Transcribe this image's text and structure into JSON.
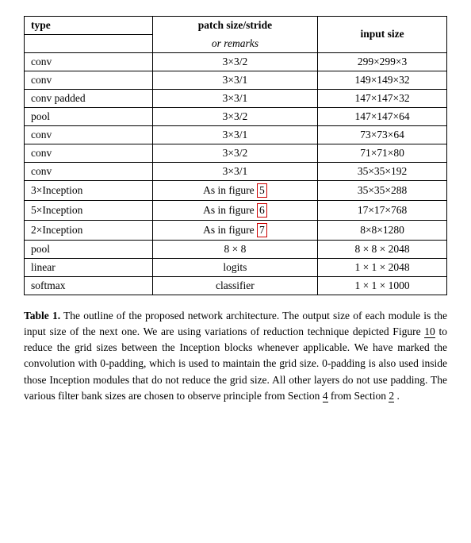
{
  "table": {
    "headers": {
      "type": "type",
      "patch": "patch size/stride",
      "remarks": "or remarks",
      "input": "input size"
    },
    "rows": [
      {
        "type": "conv",
        "patch": "3×3/2",
        "input": "299×299×3"
      },
      {
        "type": "conv",
        "patch": "3×3/1",
        "input": "149×149×32"
      },
      {
        "type": "conv padded",
        "patch": "3×3/1",
        "input": "147×147×32"
      },
      {
        "type": "pool",
        "patch": "3×3/2",
        "input": "147×147×64"
      },
      {
        "type": "conv",
        "patch": "3×3/1",
        "input": "73×73×64"
      },
      {
        "type": "conv",
        "patch": "3×3/2",
        "input": "71×71×80"
      },
      {
        "type": "conv",
        "patch": "3×3/1",
        "input": "35×35×192"
      },
      {
        "type": "3×Inception",
        "patch": "As in figure 5",
        "input": "35×35×288",
        "highlight": "5"
      },
      {
        "type": "5×Inception",
        "patch": "As in figure 6",
        "input": "17×17×768",
        "highlight": "6"
      },
      {
        "type": "2×Inception",
        "patch": "As in figure 7",
        "input": "8×8×1280",
        "highlight": "7"
      },
      {
        "type": "pool",
        "patch": "8 × 8",
        "input": "8 × 8 × 2048"
      },
      {
        "type": "linear",
        "patch": "logits",
        "input": "1 × 1 × 2048"
      },
      {
        "type": "softmax",
        "patch": "classifier",
        "input": "1 × 1 × 1000"
      }
    ]
  },
  "caption": {
    "label": "Table 1.",
    "text": " The outline of the proposed network architecture.  The output size of each module is the input size of the next one.  We are using variations of reduction technique depicted Figure ",
    "ref10": "10",
    "text2": " to reduce the grid sizes between the Inception blocks whenever applicable. We have marked the convolution with 0-padding, which is used to maintain the grid size.  0-padding is also used inside those Inception modules that do not reduce the grid size. All other layers do not use padding. The various filter bank sizes are chosen to observe principle ",
    "ref4": "4",
    "text3": " from Section ",
    "ref2": "2",
    "text4": "."
  }
}
